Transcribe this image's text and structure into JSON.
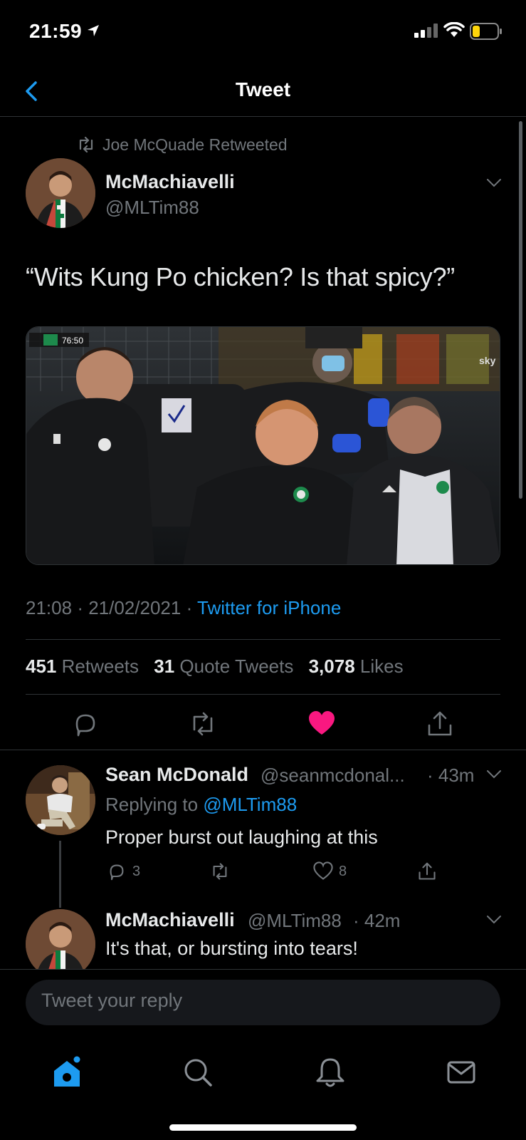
{
  "status_bar": {
    "time": "21:59"
  },
  "nav": {
    "title": "Tweet"
  },
  "tweet": {
    "retweeted_by": "Joe McQuade Retweeted",
    "author_name": "McMachiavelli",
    "author_handle": "@MLTim88",
    "text": "“Wits Kung Po chicken? Is that spicy?”",
    "media": {
      "scoreboard_time": "76:50",
      "broadcaster": "sky"
    },
    "time": "21:08",
    "date": "21/02/2021",
    "source": "Twitter for iPhone",
    "stats": {
      "retweets_count": "451",
      "retweets_label": "Retweets",
      "quotes_count": "31",
      "quotes_label": "Quote Tweets",
      "likes_count": "3,078",
      "likes_label": "Likes"
    },
    "liked": true
  },
  "replies": [
    {
      "name": "Sean McDonald",
      "handle": "@seanmcdonal...",
      "age": "· 43m",
      "replying_prefix": "Replying to",
      "replying_to": "@MLTim88",
      "text": "Proper burst out laughing at this",
      "reply_count": "3",
      "like_count": "8"
    },
    {
      "name": "McMachiavelli",
      "handle": "@MLTim88",
      "age": "· 42m",
      "text": "It's that, or bursting into tears!"
    }
  ],
  "compose": {
    "placeholder": "Tweet your reply"
  },
  "colors": {
    "accent": "#1d9bf0",
    "like": "#f91880",
    "background": "#000000",
    "secondary_text": "#71767b"
  },
  "icons": [
    "back-icon",
    "retweet-icon",
    "reply-icon",
    "heart-icon",
    "share-icon",
    "home-icon",
    "search-icon",
    "bell-icon",
    "mail-icon"
  ]
}
